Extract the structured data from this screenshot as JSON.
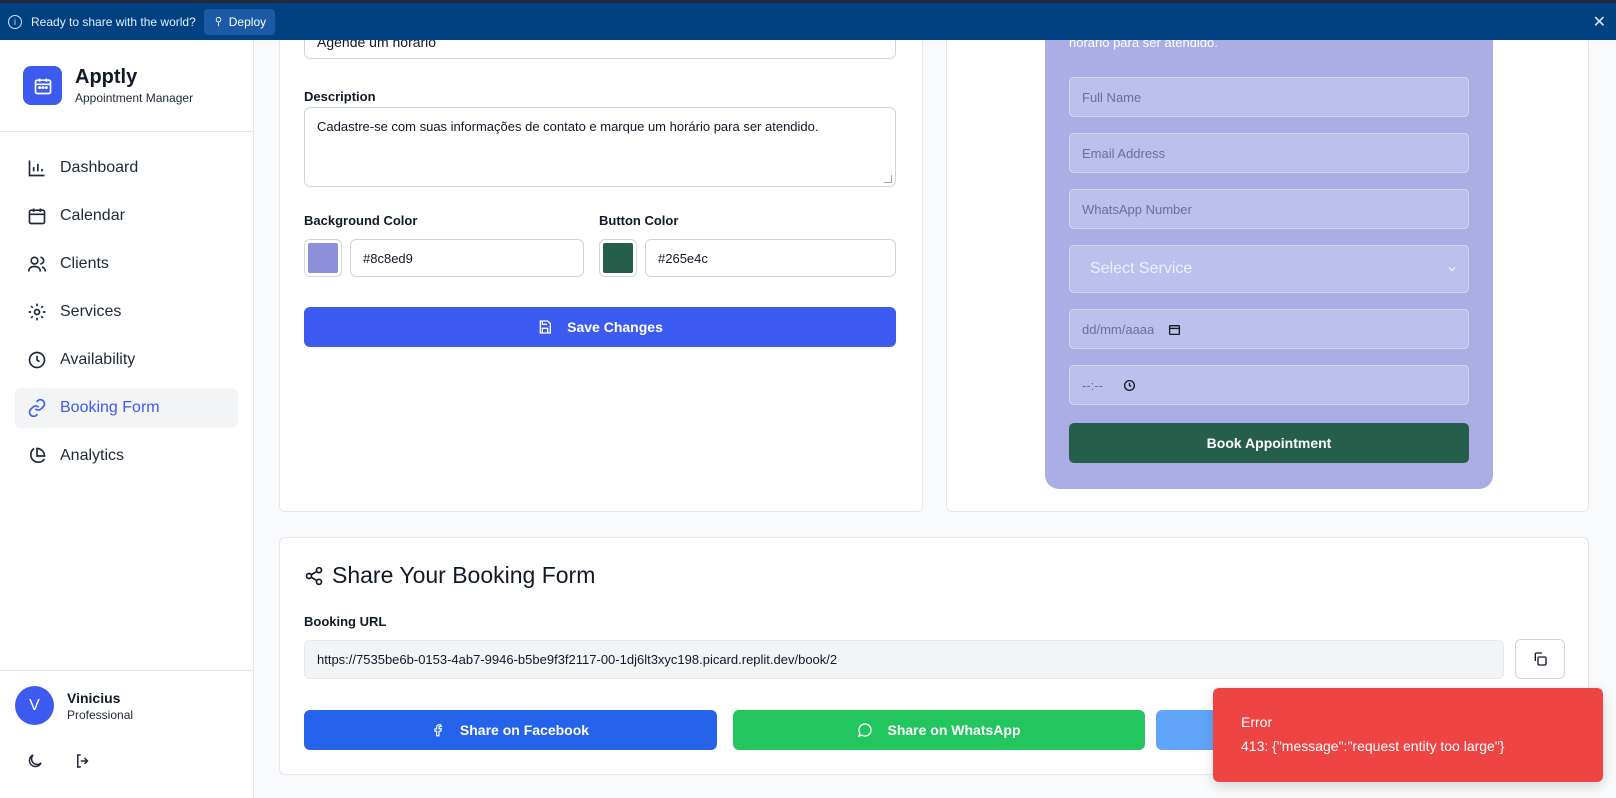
{
  "banner": {
    "message": "Ready to share with the world?",
    "deploy_label": "Deploy"
  },
  "brand": {
    "name": "Apptly",
    "subtitle": "Appointment Manager",
    "accent": "#3d5af1"
  },
  "sidebar": {
    "items": [
      {
        "label": "Dashboard",
        "icon": "bar-chart-icon",
        "active": false
      },
      {
        "label": "Calendar",
        "icon": "calendar-icon",
        "active": false
      },
      {
        "label": "Clients",
        "icon": "users-icon",
        "active": false
      },
      {
        "label": "Services",
        "icon": "gear-icon",
        "active": false
      },
      {
        "label": "Availability",
        "icon": "clock-icon",
        "active": false
      },
      {
        "label": "Booking Form",
        "icon": "link-icon",
        "active": true
      },
      {
        "label": "Analytics",
        "icon": "pie-chart-icon",
        "active": false
      }
    ]
  },
  "user": {
    "initial": "V",
    "name": "Vinicius",
    "plan": "Professional"
  },
  "form_settings": {
    "title_value": "Agende um horário",
    "description_label": "Description",
    "description_value": "Cadastre-se com suas informações de contato e marque um horário para ser atendido.",
    "bg_color_label": "Background Color",
    "bg_color_value": "#8c8ed9",
    "button_color_label": "Button Color",
    "button_color_value": "#265e4c",
    "save_label": "Save Changes"
  },
  "preview": {
    "description_tail": "horário para ser atendido.",
    "full_name_placeholder": "Full Name",
    "email_placeholder": "Email Address",
    "whatsapp_placeholder": "WhatsApp Number",
    "service_placeholder": "Select Service",
    "date_placeholder": "dd/mm/aaaa",
    "time_placeholder": "--:--",
    "book_label": "Book Appointment"
  },
  "share": {
    "title": "Share Your Booking Form",
    "url_label": "Booking URL",
    "url": "https://7535be6b-0153-4ab7-9946-b5be9f3f2117-00-1dj6lt3xyc198.picard.replit.dev/book/2",
    "facebook_label": "Share on Facebook",
    "whatsapp_label": "Share on WhatsApp",
    "facebook_color": "#2563eb",
    "whatsapp_color": "#22c55e",
    "third_color": "#60a5fa"
  },
  "toast": {
    "title": "Error",
    "message": "413: {\"message\":\"request entity too large\"}"
  }
}
